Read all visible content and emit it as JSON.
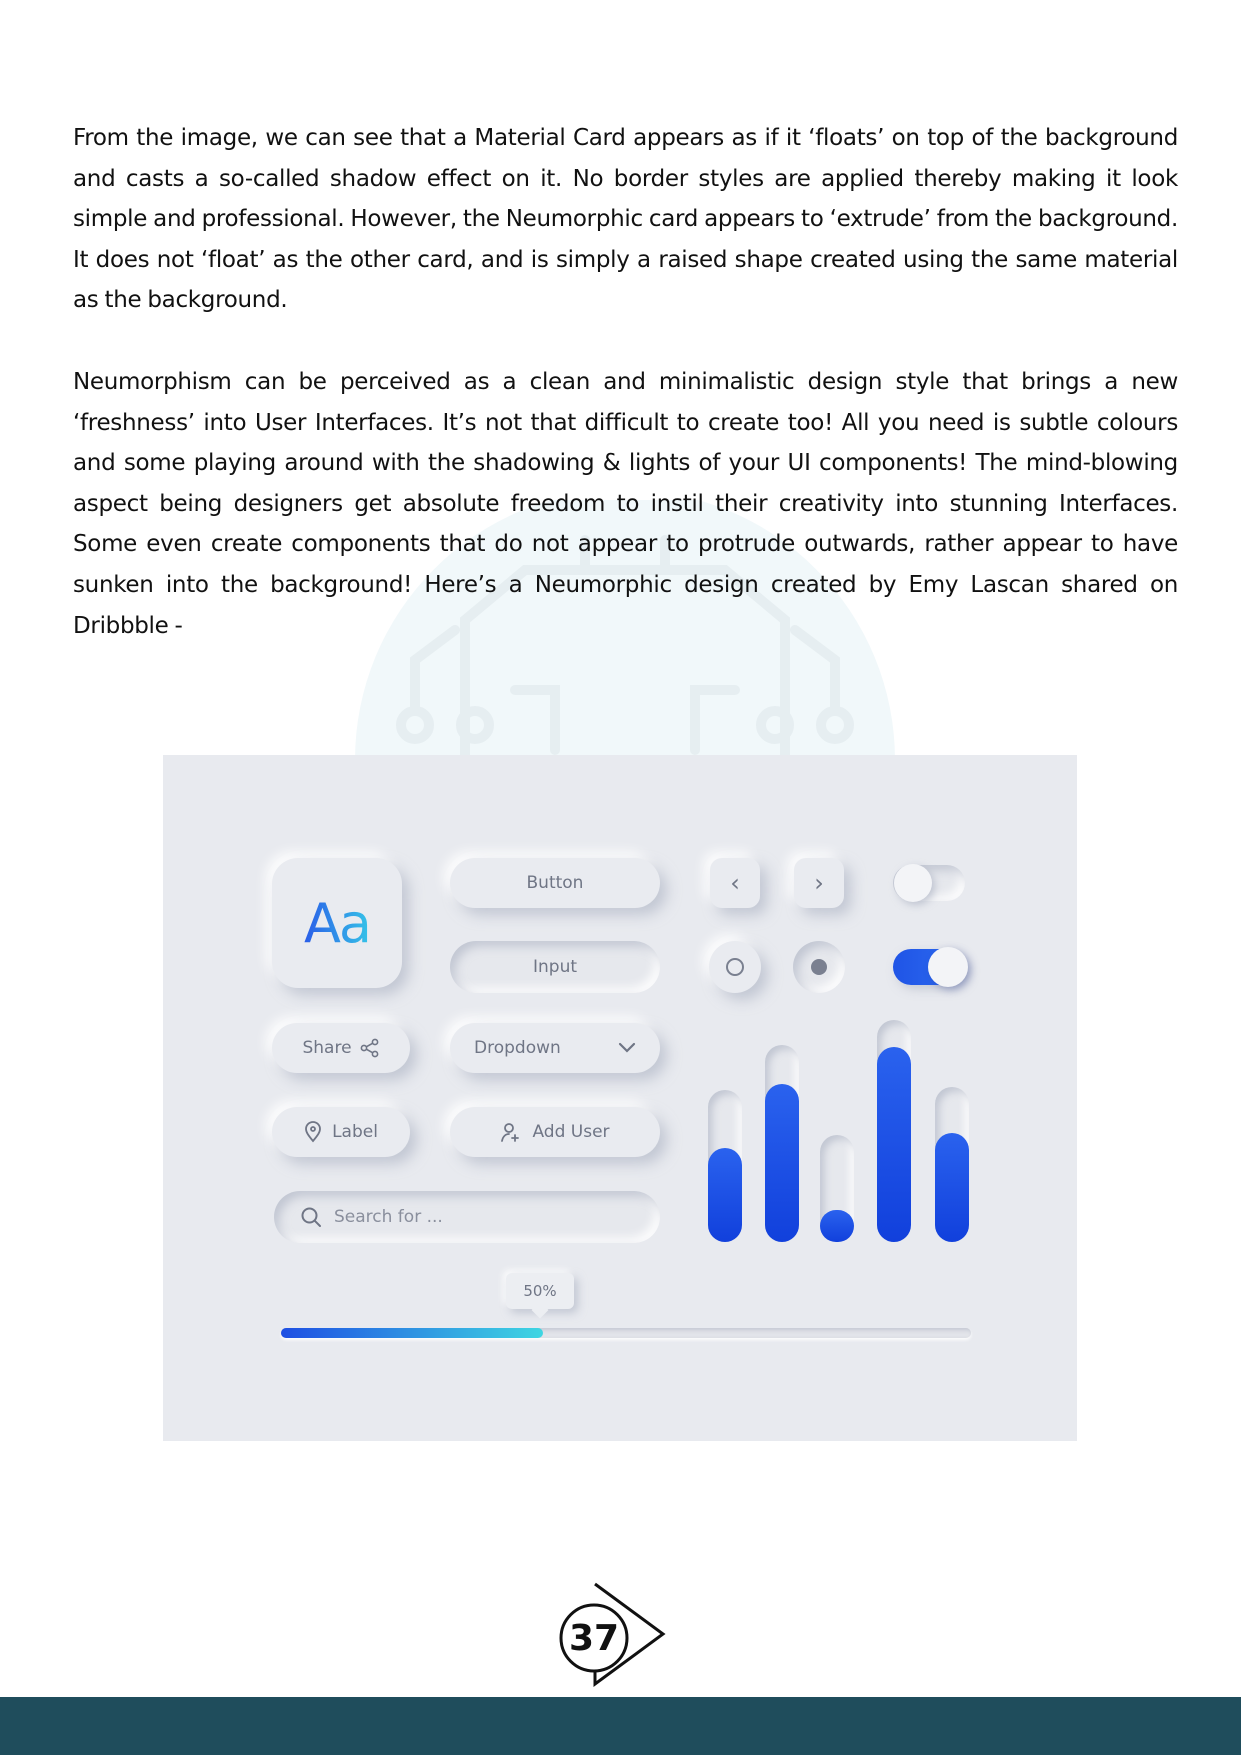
{
  "paragraphs": {
    "p1": "From the image, we can see that a Material Card appears as if it ‘floats’ on top of the background and casts a so-called shadow effect on it. No border styles are applied thereby making it look simple and professional. However, the Neumorphic card appears to ‘extrude’ from the background. It does not ‘float’ as the other card, and is simply a raised shape created using the same material as the background.",
    "p2": "Neumorphism can be perceived as a clean and minimalistic design style that brings a new ‘freshness’ into User Interfaces. It’s not that difficult to create too! All you need is subtle colours and some playing around with the shadowing & lights of your UI components! The mind-blowing aspect being designers get absolute freedom to instil their creativity into stunning Interfaces. Some even create components that do not appear to protrude outwards, rather appear to have sunken into the background! Here’s a Neumorphic design created by Emy Lascan shared on Dribbble -"
  },
  "figure": {
    "typography_sample": "Aa",
    "button_label": "Button",
    "input_label": "Input",
    "share_label": "Share",
    "dropdown_label": "Dropdown",
    "label_label": "Label",
    "add_user_label": "Add User",
    "search_placeholder": "Search for ...",
    "prev_glyph": "‹",
    "next_glyph": "›",
    "radio_a_checked": false,
    "radio_b_checked": true,
    "toggle_1_on": false,
    "toggle_2_on": true,
    "bar_levels": [
      0.62,
      0.8,
      0.3,
      0.88,
      0.7
    ],
    "progress_label": "50%",
    "progress_value": 0.38,
    "accent_color": "#1f54e6",
    "background_color": "#e8eaef",
    "icons": [
      "share-icon",
      "chevron-down-icon",
      "location-pin-icon",
      "add-user-icon",
      "search-icon"
    ]
  },
  "page_number": "37",
  "footer_color": "#1f4d5c"
}
